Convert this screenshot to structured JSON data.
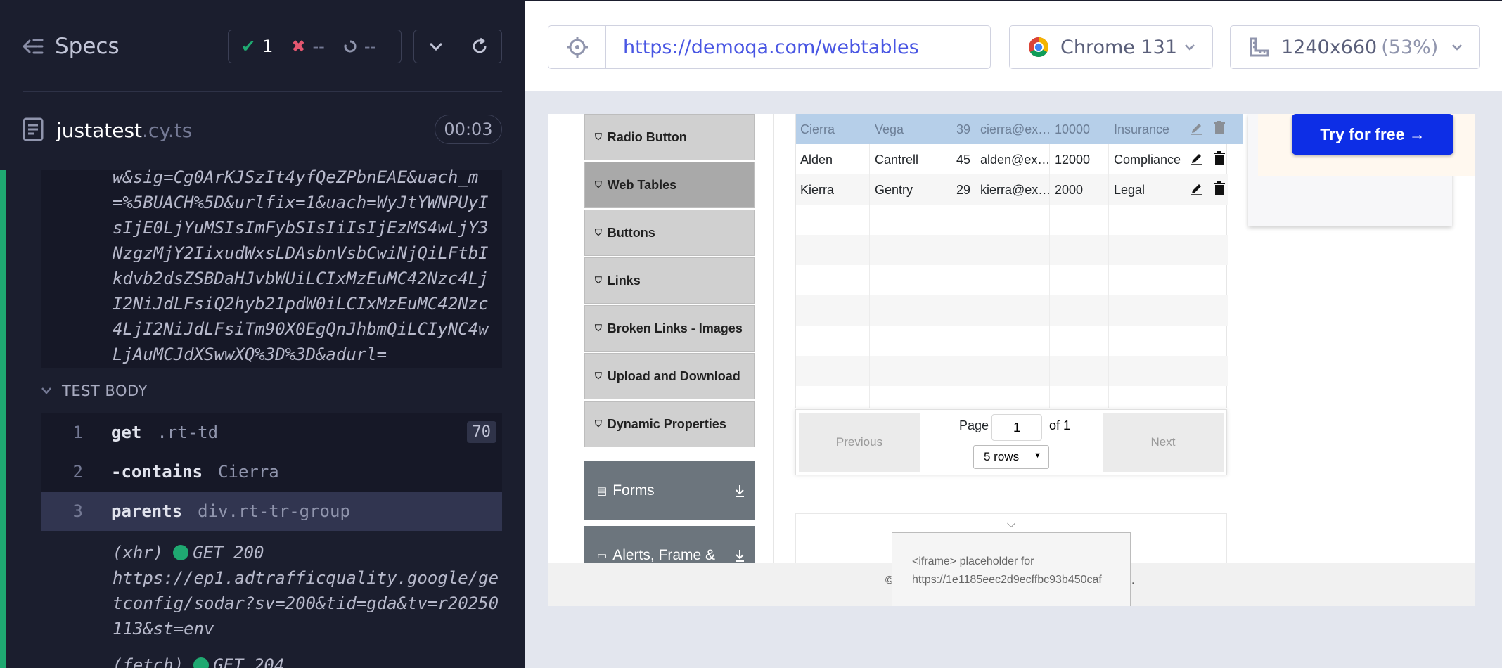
{
  "reporter": {
    "specs_label": "Specs",
    "stats": {
      "passed": "1",
      "failed": "--",
      "pending": "--"
    },
    "spec": {
      "name": "justatest",
      "ext": ".cy.ts",
      "duration": "00:03"
    },
    "previous_log_url": "w&sig=Cg0ArKJSzIt4yfQeZPbnEAE&uach_m=%5BUACH%5D&urlfix=1&uach=WyJtYWNPUyIsIjE0LjYuMSIsImFybSIsIiIsIjEzMS4wLjY3NzgzMjY2IixudWxsLDAsbnVsbCwiNjQiLFtbIkdvb2dsZSBDaHJvbWUiLCIxMzEuMC42Nzc4LjI2NiJdLFsiQ2hyb21pdW0iLCIxMzEuMC42Nzc4LjI2NiJdLFsiTm90X0EgQnJhbmQiLCIyNC4wLjAuMCJdXSwwXQ%3D%3D&adurl=",
    "section_title": "TEST BODY",
    "commands": [
      {
        "num": "1",
        "name": "get",
        "arg": ".rt-td",
        "badge": "70"
      },
      {
        "num": "2",
        "name": "-contains",
        "arg": "Cierra",
        "badge": ""
      },
      {
        "num": "3",
        "name": "parents",
        "arg": "div.rt-tr-group",
        "badge": ""
      }
    ],
    "requests": [
      {
        "type": "(xhr)",
        "status": "GET 200",
        "url": "https://ep1.adtrafficquality.google/getconfig/sodar?sv=200&tid=gda&tv=r20250113&st=env"
      },
      {
        "type": "(fetch)",
        "status": "GET 204",
        "url": ""
      }
    ],
    "colors": {
      "pass": "#1fa971",
      "fail": "#e45770"
    }
  },
  "aut_bar": {
    "url": "https://demoqa.com/webtables",
    "browser": "Chrome 131",
    "viewport": "1240x660",
    "zoom": "(53%)"
  },
  "app": {
    "sidebar": [
      {
        "label": "Radio Button",
        "active": false
      },
      {
        "label": "Web Tables",
        "active": true
      },
      {
        "label": "Buttons",
        "active": false
      },
      {
        "label": "Links",
        "active": false
      },
      {
        "label": "Broken Links - Images",
        "active": false
      },
      {
        "label": "Upload and Download",
        "active": false
      },
      {
        "label": "Dynamic Properties",
        "active": false
      }
    ],
    "groups": [
      {
        "label": "Forms"
      },
      {
        "label": "Alerts, Frame &"
      }
    ],
    "rows": [
      {
        "first": "Cierra",
        "last": "Vega",
        "age": "39",
        "email": "cierra@ex…",
        "salary": "10000",
        "dept": "Insurance"
      },
      {
        "first": "Alden",
        "last": "Cantrell",
        "age": "45",
        "email": "alden@ex…",
        "salary": "12000",
        "dept": "Compliance"
      },
      {
        "first": "Kierra",
        "last": "Gentry",
        "age": "29",
        "email": "kierra@ex…",
        "salary": "2000",
        "dept": "Legal"
      }
    ],
    "pagination": {
      "previous": "Previous",
      "next": "Next",
      "page_label": "Page",
      "page_value": "1",
      "of_label": "of 1",
      "rows_option": "5 rows"
    },
    "ad": {
      "cta": "Try for free →"
    },
    "iframe_placeholder": {
      "line1": "<iframe> placeholder for",
      "line2": "https://1e1185eec2d9ecffbc93b450caf"
    },
    "footer_left": "©",
    "footer_right": "."
  }
}
